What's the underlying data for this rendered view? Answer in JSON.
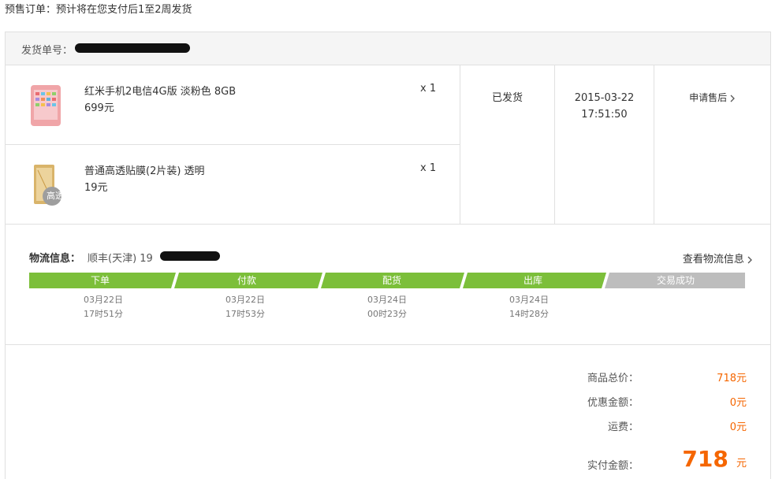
{
  "presale_note": "预售订单：预计将在您支付后1至2周发货",
  "shipment": {
    "label": "发货单号："
  },
  "items": [
    {
      "name": "红米手机2电信4G版 淡粉色 8GB",
      "price": "699元",
      "qty": "x 1",
      "thumb": "pink-phone"
    },
    {
      "name": "普通高透贴膜(2片装) 透明",
      "price": "19元",
      "qty": "x 1",
      "thumb": "screen-film",
      "badge": "高透"
    }
  ],
  "status": "已发货",
  "time": {
    "date": "2015-03-22",
    "clock": "17:51:50"
  },
  "action": {
    "label": "申请售后"
  },
  "logistics": {
    "label": "物流信息：",
    "carrier": "顺丰(天津) 19",
    "link_label": "查看物流信息"
  },
  "steps": [
    {
      "label": "下单",
      "date": "03月22日",
      "time": "17时51分",
      "done": true
    },
    {
      "label": "付款",
      "date": "03月22日",
      "time": "17时53分",
      "done": true
    },
    {
      "label": "配货",
      "date": "03月24日",
      "time": "00时23分",
      "done": true
    },
    {
      "label": "出库",
      "date": "03月24日",
      "time": "14时28分",
      "done": true
    },
    {
      "label": "交易成功",
      "date": "",
      "time": "",
      "done": false
    }
  ],
  "colors": {
    "done": "#7cbf3a",
    "todo": "#bdbdbd",
    "accent": "#f56600"
  },
  "totals": {
    "goods_label": "商品总价：",
    "goods_value": "718元",
    "discount_label": "优惠金额：",
    "discount_value": "0元",
    "shipping_label": "运费：",
    "shipping_value": "0元",
    "paid_label": "实付金额：",
    "paid_value": "718",
    "paid_unit": "元"
  }
}
